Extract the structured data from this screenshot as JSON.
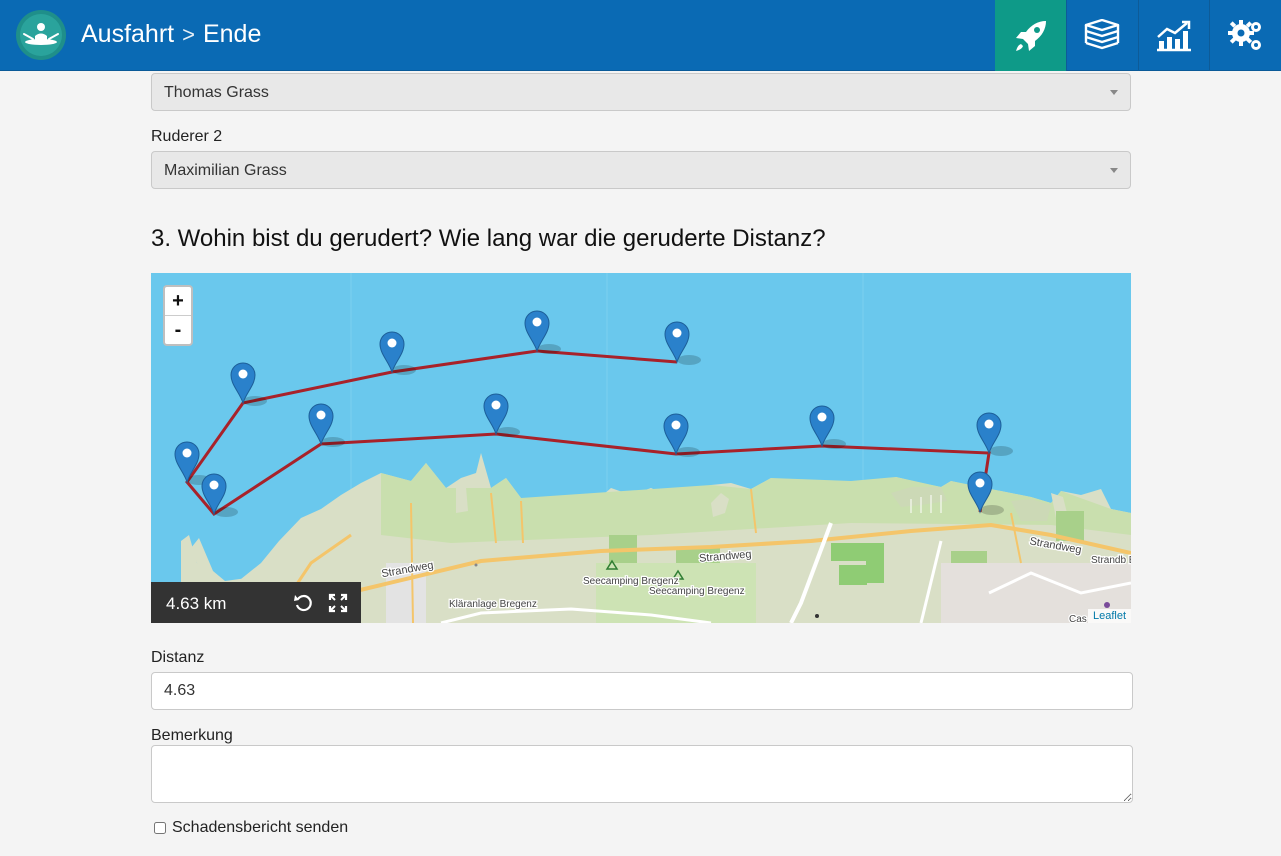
{
  "header": {
    "breadcrumb": [
      "Ausfahrt",
      "Ende"
    ],
    "separator": ">",
    "nav": [
      {
        "icon": "rocket-icon",
        "active": true
      },
      {
        "icon": "book-stack-icon",
        "active": false
      },
      {
        "icon": "chart-trend-icon",
        "active": false
      },
      {
        "icon": "gears-icon",
        "active": false
      }
    ],
    "colors": {
      "bar": "#0a6ab4",
      "active": "#0e9a88"
    }
  },
  "form": {
    "rower1_value": "Thomas Grass",
    "rower2_label": "Ruderer 2",
    "rower2_value": "Maximilian Grass",
    "section_heading": "3. Wohin bist du gerudert? Wie lang war die geruderte Distanz?",
    "distance_label": "Distanz",
    "distance_value": "4.63",
    "remark_label": "Bemerkung",
    "remark_value": "",
    "damage_report_label": "Schadensbericht senden",
    "damage_report_checked": false
  },
  "map": {
    "zoom_in": "+",
    "zoom_out": "-",
    "distance_display": "4.63 km",
    "attribution": "Leaflet",
    "place_labels": [
      "Strandweg",
      "Strandweg",
      "Strandweg",
      "Seecamping Bregenz",
      "Seecamping Bregenz",
      "Kläranlage Bregenz",
      "Strandb Bregen",
      "Cas"
    ],
    "colors": {
      "water": "#6ac8ed",
      "route": "#a8222a",
      "marker": "#2a81cb"
    }
  }
}
